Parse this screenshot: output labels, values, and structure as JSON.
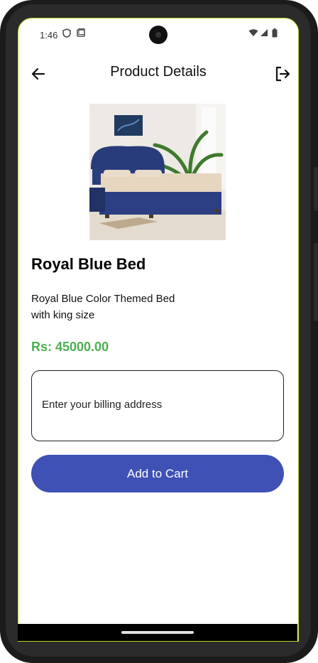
{
  "status_bar": {
    "time": "1:46"
  },
  "app_bar": {
    "title": "Product Details"
  },
  "product": {
    "name": "Royal Blue Bed",
    "description": "Royal Blue Color Themed Bed with king size",
    "price": "Rs: 45000.00"
  },
  "billing": {
    "placeholder": "Enter your billing address",
    "value": ""
  },
  "actions": {
    "add_to_cart": "Add to Cart"
  },
  "colors": {
    "price": "#4caf50",
    "button": "#3f51b5"
  },
  "icons": {
    "back": "arrow-left-icon",
    "logout": "logout-icon",
    "shield": "shield-icon",
    "sim": "sim-card-icon",
    "wifi": "wifi-icon",
    "signal": "signal-icon",
    "battery": "battery-icon"
  }
}
